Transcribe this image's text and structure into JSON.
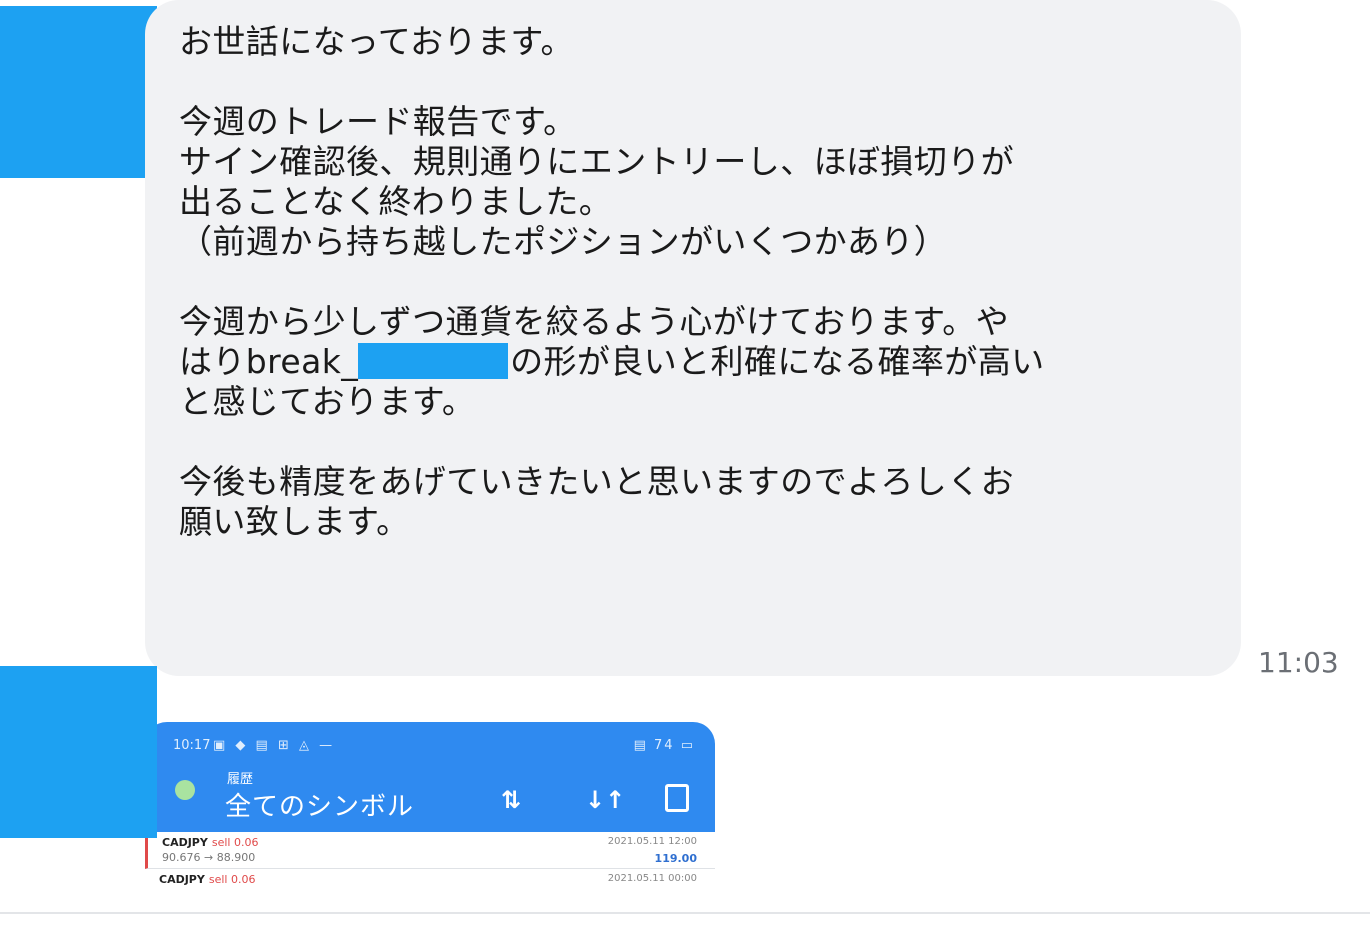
{
  "message": {
    "lines": [
      "お世話になっております。",
      "",
      "今週のトレード報告です。",
      "サイン確認後、規則通りにエントリーし、ほぼ損切りが",
      "出ることなく終わりました。",
      "（前週から持ち越したポジションがいくつかあり）",
      "",
      "今週から少しずつ通貨を絞るよう心がけております。や"
    ],
    "line_break_before": "はりbreak_",
    "line_break_after": "の形が良いと利確になる確率が高い",
    "lines_after": [
      "と感じております。",
      "",
      "今後も精度をあげていきたいと思いますのでよろしくお",
      "願い致します。"
    ],
    "time": "11:03"
  },
  "attachment": {
    "status_time": "10:17",
    "status_icons": "▣ ◆ ▤ ⊞ ◬ —",
    "status_right": "▤ 74 ▭",
    "subtitle": "履歴",
    "title": "全てのシンボル",
    "trades": [
      {
        "symbol": "CADJPY",
        "side": "sell 0.06",
        "price": "90.676 → 88.900",
        "time": "2021.05.11 12:00",
        "profit": "119.00"
      },
      {
        "symbol": "CADJPY",
        "side": "sell 0.06",
        "price": "",
        "time": "2021.05.11 00:00",
        "profit": ""
      }
    ]
  },
  "colors": {
    "redaction": "#1da1f2",
    "bubble": "#f1f2f4",
    "app_header": "#2f8af0",
    "sell": "#e04a4a",
    "profit": "#2f6fd0"
  },
  "icons": {
    "tool_1": "filter-icon",
    "tool_2": "sort-icon",
    "tool_3": "calendar-icon"
  }
}
